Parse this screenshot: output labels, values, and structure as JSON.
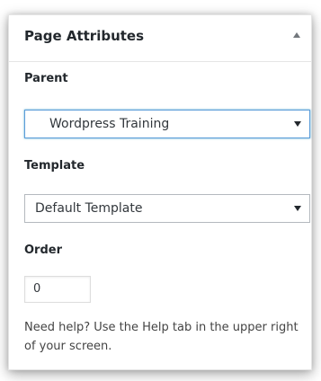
{
  "panel": {
    "title": "Page Attributes",
    "toggle_icon": "triangle-up-icon"
  },
  "parent": {
    "label": "Parent",
    "selected": "Wordpress Training"
  },
  "template": {
    "label": "Template",
    "selected": "Default Template"
  },
  "order": {
    "label": "Order",
    "value": "0"
  },
  "help": {
    "text": "Need help? Use the Help tab in the upper right of your screen."
  },
  "colors": {
    "focus_border": "#5b9dd9",
    "text": "#23282d"
  }
}
